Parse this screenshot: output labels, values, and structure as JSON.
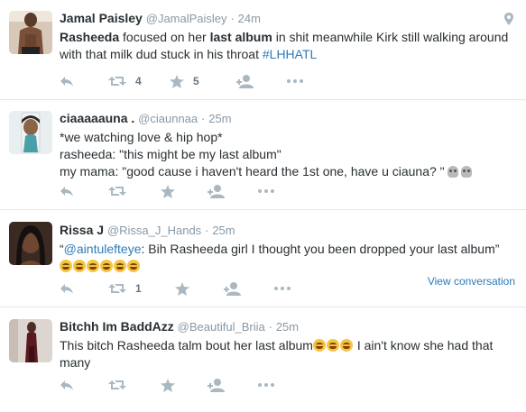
{
  "tweets": [
    {
      "name": "Jamal Paisley",
      "handle": "@JamalPaisley",
      "dot": "·",
      "time": "24m",
      "text_parts": [
        "Rasheeda",
        " focused on her ",
        "last album",
        " in shit meanwhile Kirk still walking around with that milk dud stuck in his throat ",
        "#LHHATL"
      ],
      "retweets": "4",
      "favorites": "5",
      "has_location_pin": true
    },
    {
      "name": "ciaaaaauna .",
      "handle": "@ciaunnaa",
      "dot": "·",
      "time": "25m",
      "lines": [
        "*we watching love & hip hop*",
        "rasheeda: \"this might be my last album\"",
        "my mama: \"good cause i haven't heard the 1st one, have u ciauna? \""
      ],
      "retweets": "",
      "favorites": ""
    },
    {
      "name": "Rissa J",
      "handle": "@Rissa_J_Hands",
      "dot": "·",
      "time": "25m",
      "text_open_quote": "“",
      "mention": "@aintulefteye",
      "text_rest": ": Bih Rasheeda girl I thought you been dropped your last album”",
      "retweets": "1",
      "favorites": "",
      "view_conversation": "View conversation"
    },
    {
      "name": "Bitchh Im BaddAzz",
      "handle": "@Beautiful_Briia",
      "dot": "·",
      "time": "25m",
      "text_a": "This bitch Rasheeda talm bout her last album",
      "text_b": " I ain't know she had that many",
      "retweets": "",
      "favorites": ""
    }
  ],
  "icons": {
    "reply": "reply-icon",
    "retweet": "retweet-icon",
    "favorite": "star-icon",
    "follow": "follow-icon",
    "more": "more-icon",
    "location": "location-pin-icon"
  },
  "colors": {
    "icon_gray": "#aab8c2",
    "link_blue": "#2b7bb9",
    "text": "#292f33",
    "meta_gray": "#8899a6"
  }
}
